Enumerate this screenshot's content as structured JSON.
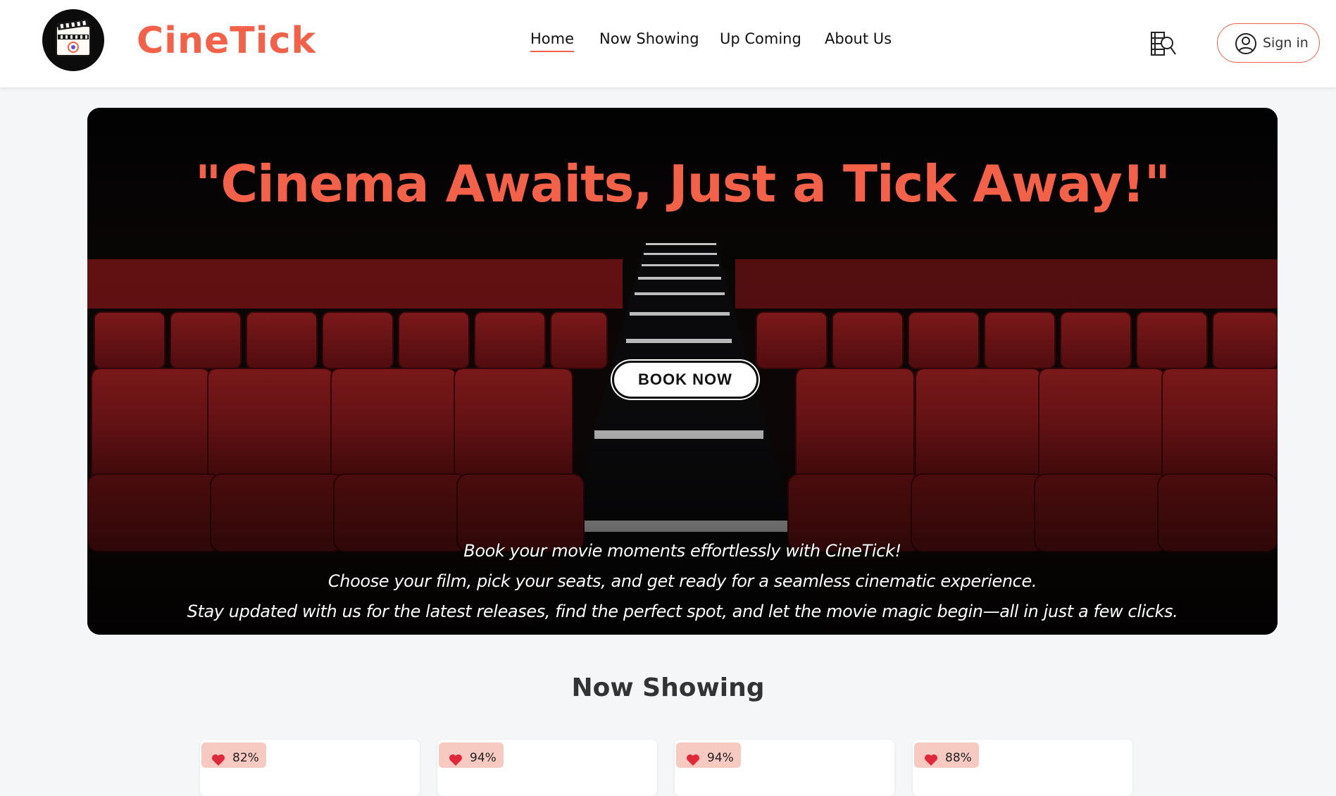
{
  "app": {
    "brand": "CineTick"
  },
  "nav": {
    "items": [
      {
        "label": "Home",
        "active": true
      },
      {
        "label": "Now Showing",
        "active": false
      },
      {
        "label": "Up Coming",
        "active": false
      },
      {
        "label": "About Us",
        "active": false
      }
    ],
    "search_icon": "film-search-icon",
    "signin_icon": "user-circle-icon",
    "signin_label": "Sign in"
  },
  "hero": {
    "title": "\"Cinema Awaits, Just a Tick Away!\"",
    "button_label": "BOOK NOW",
    "lines": [
      "Book your movie moments effortlessly with CineTick!",
      "Choose your film, pick your seats, and get ready for a seamless cinematic experience.",
      "Stay updated with us for the latest releases, find the perfect spot, and let the movie magic begin—all in just a few clicks."
    ]
  },
  "now_showing": {
    "title": "Now Showing",
    "cards": [
      {
        "rating": "82%",
        "icon": "heart-icon"
      },
      {
        "rating": "94%",
        "icon": "heart-icon"
      },
      {
        "rating": "94%",
        "icon": "heart-icon"
      },
      {
        "rating": "88%",
        "icon": "heart-icon"
      }
    ]
  },
  "colors": {
    "accent": "#f26148",
    "page_bg": "#f5f6f8",
    "seat_red": "#7a1416",
    "badge_bg": "#f6c9c1"
  }
}
